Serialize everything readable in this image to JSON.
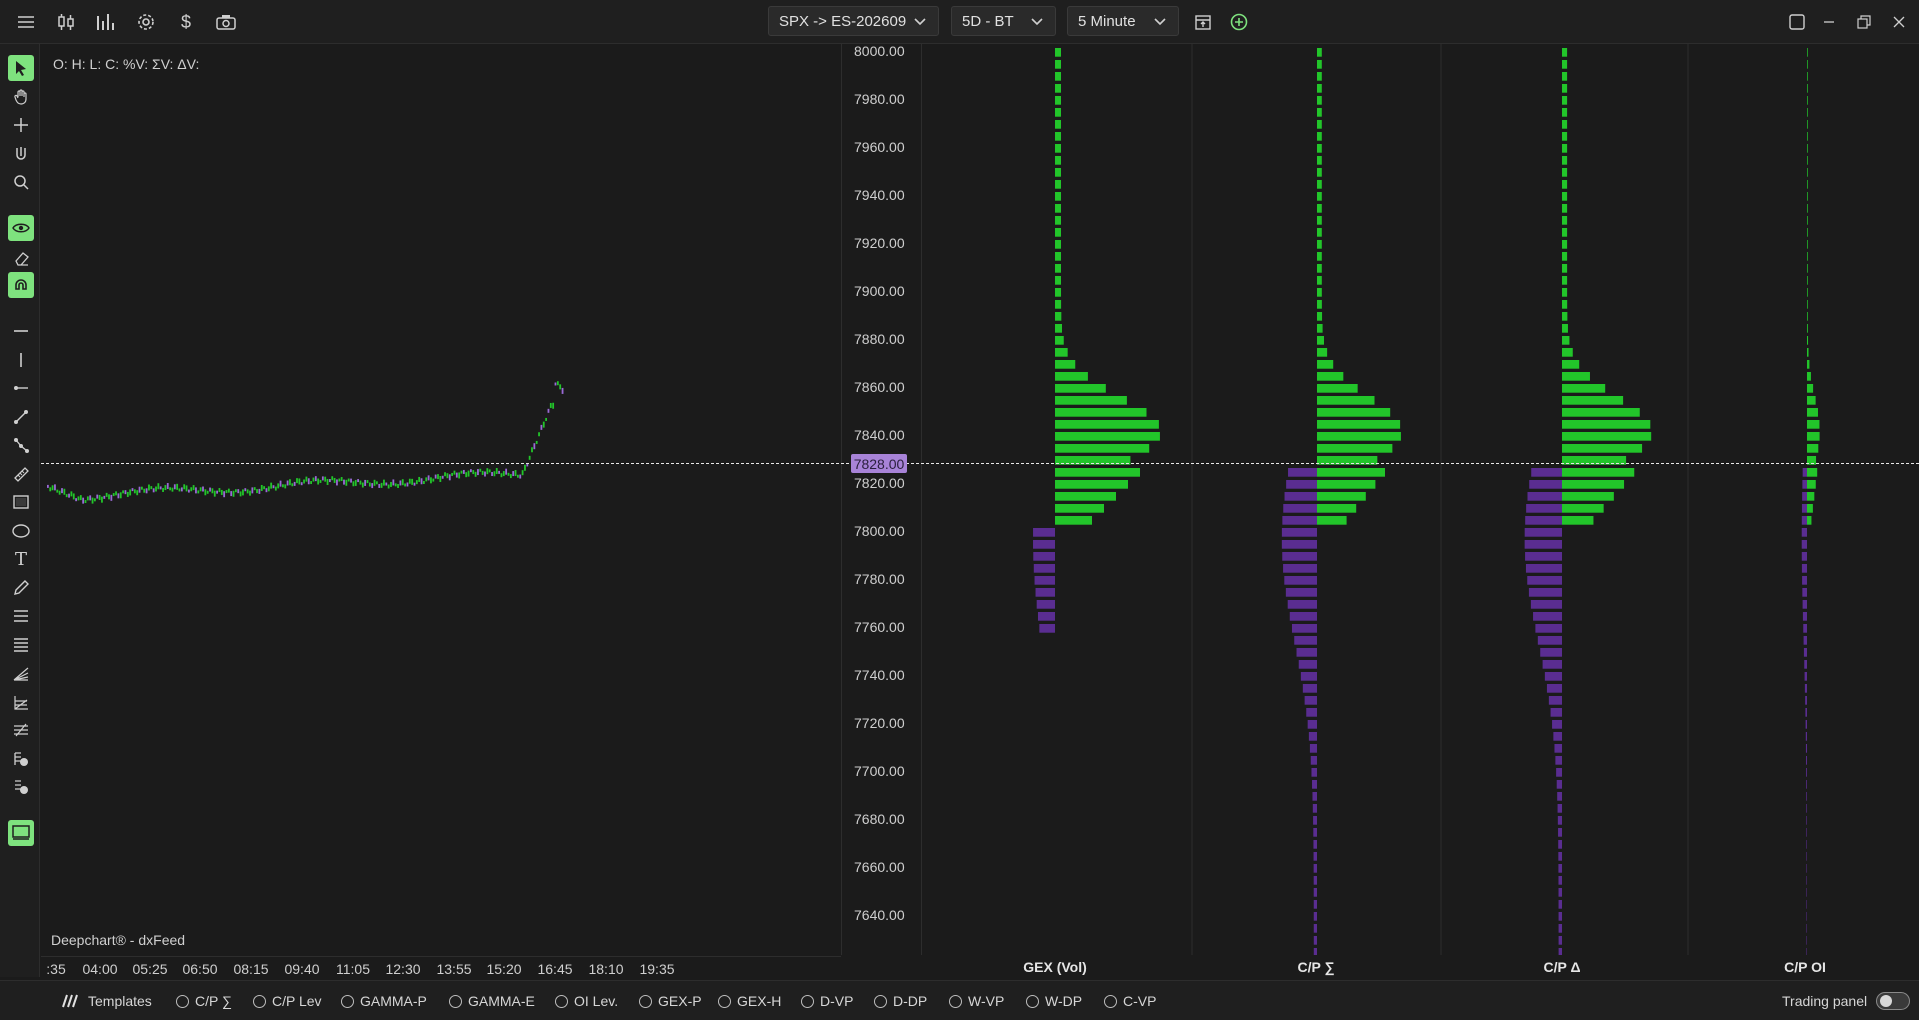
{
  "toolbar": {
    "symbol": "SPX -> ES-202609",
    "range": "5D - BT",
    "interval": "5 Minute"
  },
  "chart": {
    "ohlc_legend": "O: H: L: C: %V: ΣV: ΔV:",
    "watermark": "Deepchart® - dxFeed",
    "current_price": "7828.00",
    "price_labels": [
      "8000.00",
      "7980.00",
      "7960.00",
      "7940.00",
      "7920.00",
      "7900.00",
      "7880.00",
      "7860.00",
      "7840.00",
      "7820.00",
      "7800.00",
      "7780.00",
      "7760.00",
      "7740.00",
      "7720.00",
      "7700.00",
      "7680.00",
      "7660.00",
      "7640.00"
    ],
    "time_labels": [
      ":35",
      "04:00",
      "05:25",
      "06:50",
      "08:15",
      "09:40",
      "11:05",
      "12:30",
      "13:55",
      "15:20",
      "16:45",
      "18:10",
      "19:35"
    ]
  },
  "profiles": [
    "GEX (Vol)",
    "C/P ∑",
    "C/P Δ",
    "C/P OI"
  ],
  "bottombar": {
    "templates_label": "Templates",
    "options": [
      "C/P ∑",
      "C/P Lev",
      "GAMMA-P",
      "GAMMA-E",
      "OI Lev.",
      "GEX-P",
      "GEX-H",
      "D-VP",
      "D-DP",
      "W-VP",
      "W-DP",
      "C-VP"
    ],
    "trading_panel_label": "Trading panel"
  },
  "colors": {
    "green": "#22c52a",
    "purple": "#5a2d91",
    "accent": "#7ee27e",
    "price_tag": "#a883d8"
  }
}
